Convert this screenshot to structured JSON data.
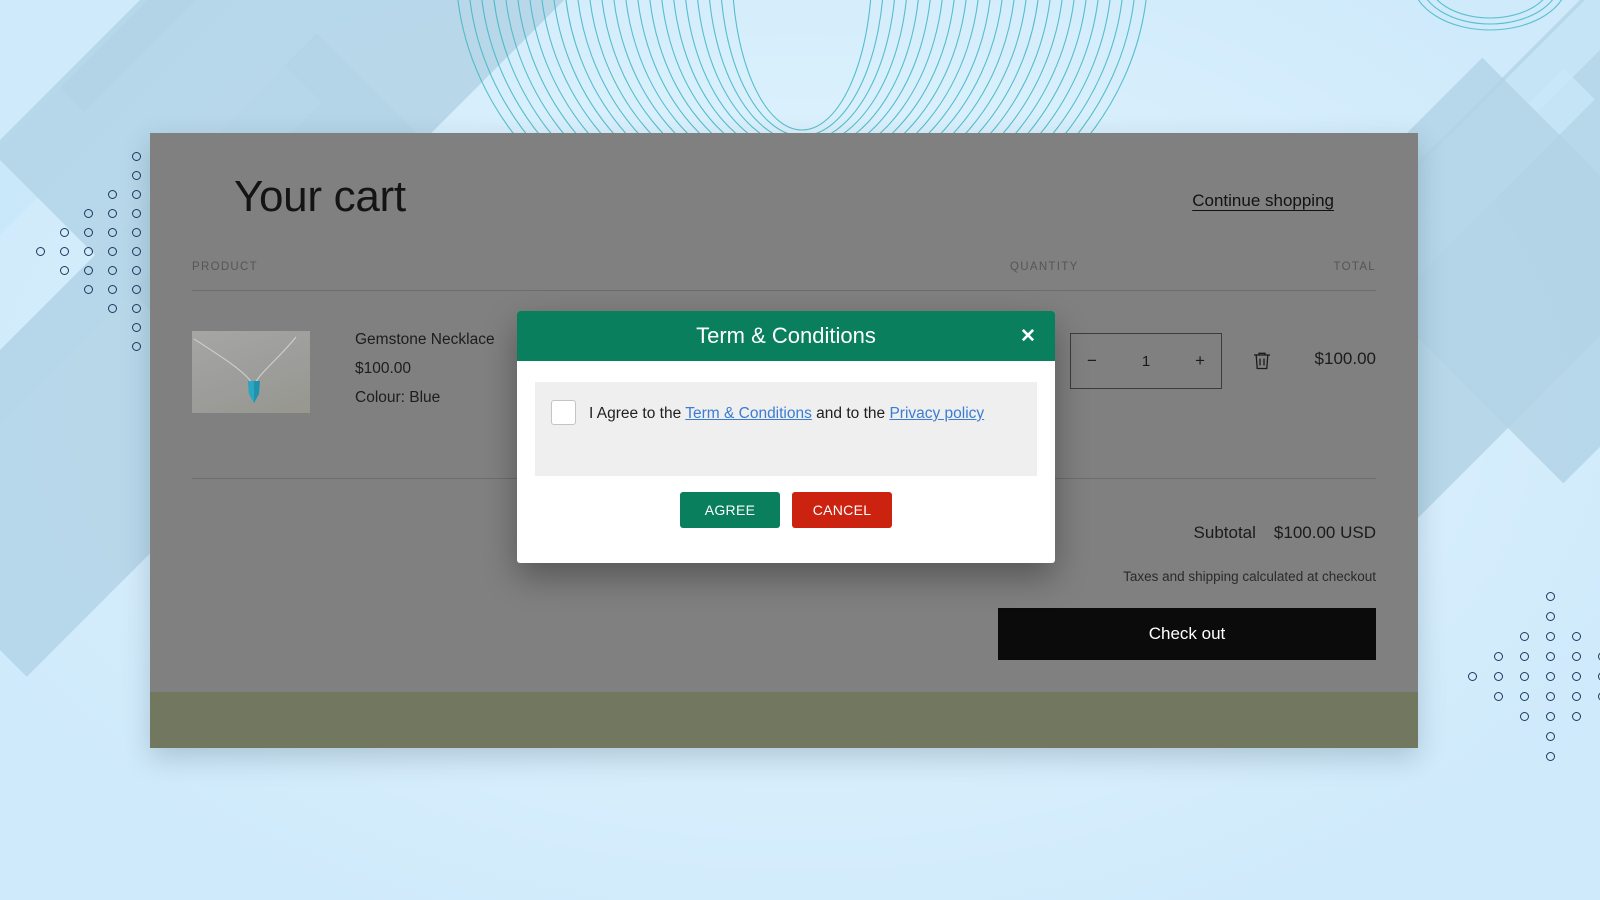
{
  "cart": {
    "title": "Your cart",
    "continue_shopping": "Continue shopping",
    "columns": {
      "product": "PRODUCT",
      "quantity": "QUANTITY",
      "total": "TOTAL"
    },
    "item": {
      "name": "Gemstone Necklace",
      "price": "$100.00",
      "variant": "Colour: Blue",
      "quantity": "1",
      "qty_decrease": "−",
      "qty_increase": "+",
      "line_total": "$100.00",
      "remove_icon": "trash-icon"
    },
    "totals": {
      "subtotal_label": "Subtotal",
      "subtotal_value": "$100.00 USD",
      "tax_note": "Taxes and shipping calculated at checkout",
      "checkout_label": "Check out"
    }
  },
  "modal": {
    "title": "Term & Conditions",
    "close_icon": "✕",
    "consent": {
      "prefix": "I Agree to the ",
      "link_terms": "Term & Conditions",
      "middle": " and to the ",
      "link_privacy": "Privacy policy"
    },
    "buttons": {
      "agree": "AGREE",
      "cancel": "CANCEL"
    }
  },
  "colors": {
    "modal_header_green": "#0a7f5e",
    "agree_green": "#0a7f5e",
    "cancel_red": "#cc2310",
    "link_blue": "#3b7cd4",
    "checkout_black": "#0b0b0b",
    "overlay_grey": "#808080",
    "footer_olive": "#72775f",
    "page_blue": "#d3eefc"
  }
}
